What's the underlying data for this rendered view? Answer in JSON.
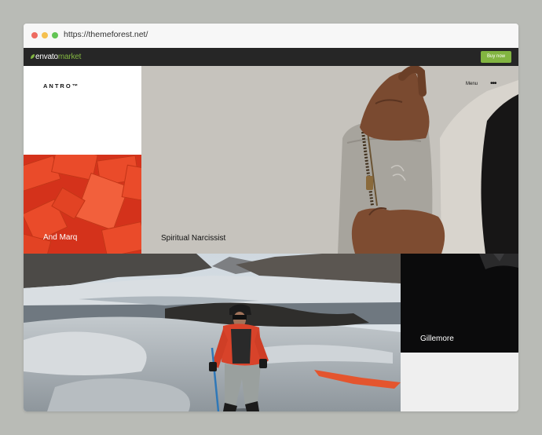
{
  "browser": {
    "url": "https://themeforest.net/",
    "traffic_lights": {
      "close": "#ed6b60",
      "minimize": "#f5c04f",
      "maximize": "#62c454"
    }
  },
  "envato_bar": {
    "logo_main": "envato",
    "logo_accent": "market",
    "buy_label": "Buy now",
    "accent_color": "#82b541"
  },
  "site": {
    "brand": "ANTRO™",
    "menu_label": "Menu",
    "more_icon": "•••",
    "tiles": {
      "and_marq": "And Marq",
      "spiritual": "Spiritual Narcissist",
      "gillemore": "Gillemore"
    }
  }
}
